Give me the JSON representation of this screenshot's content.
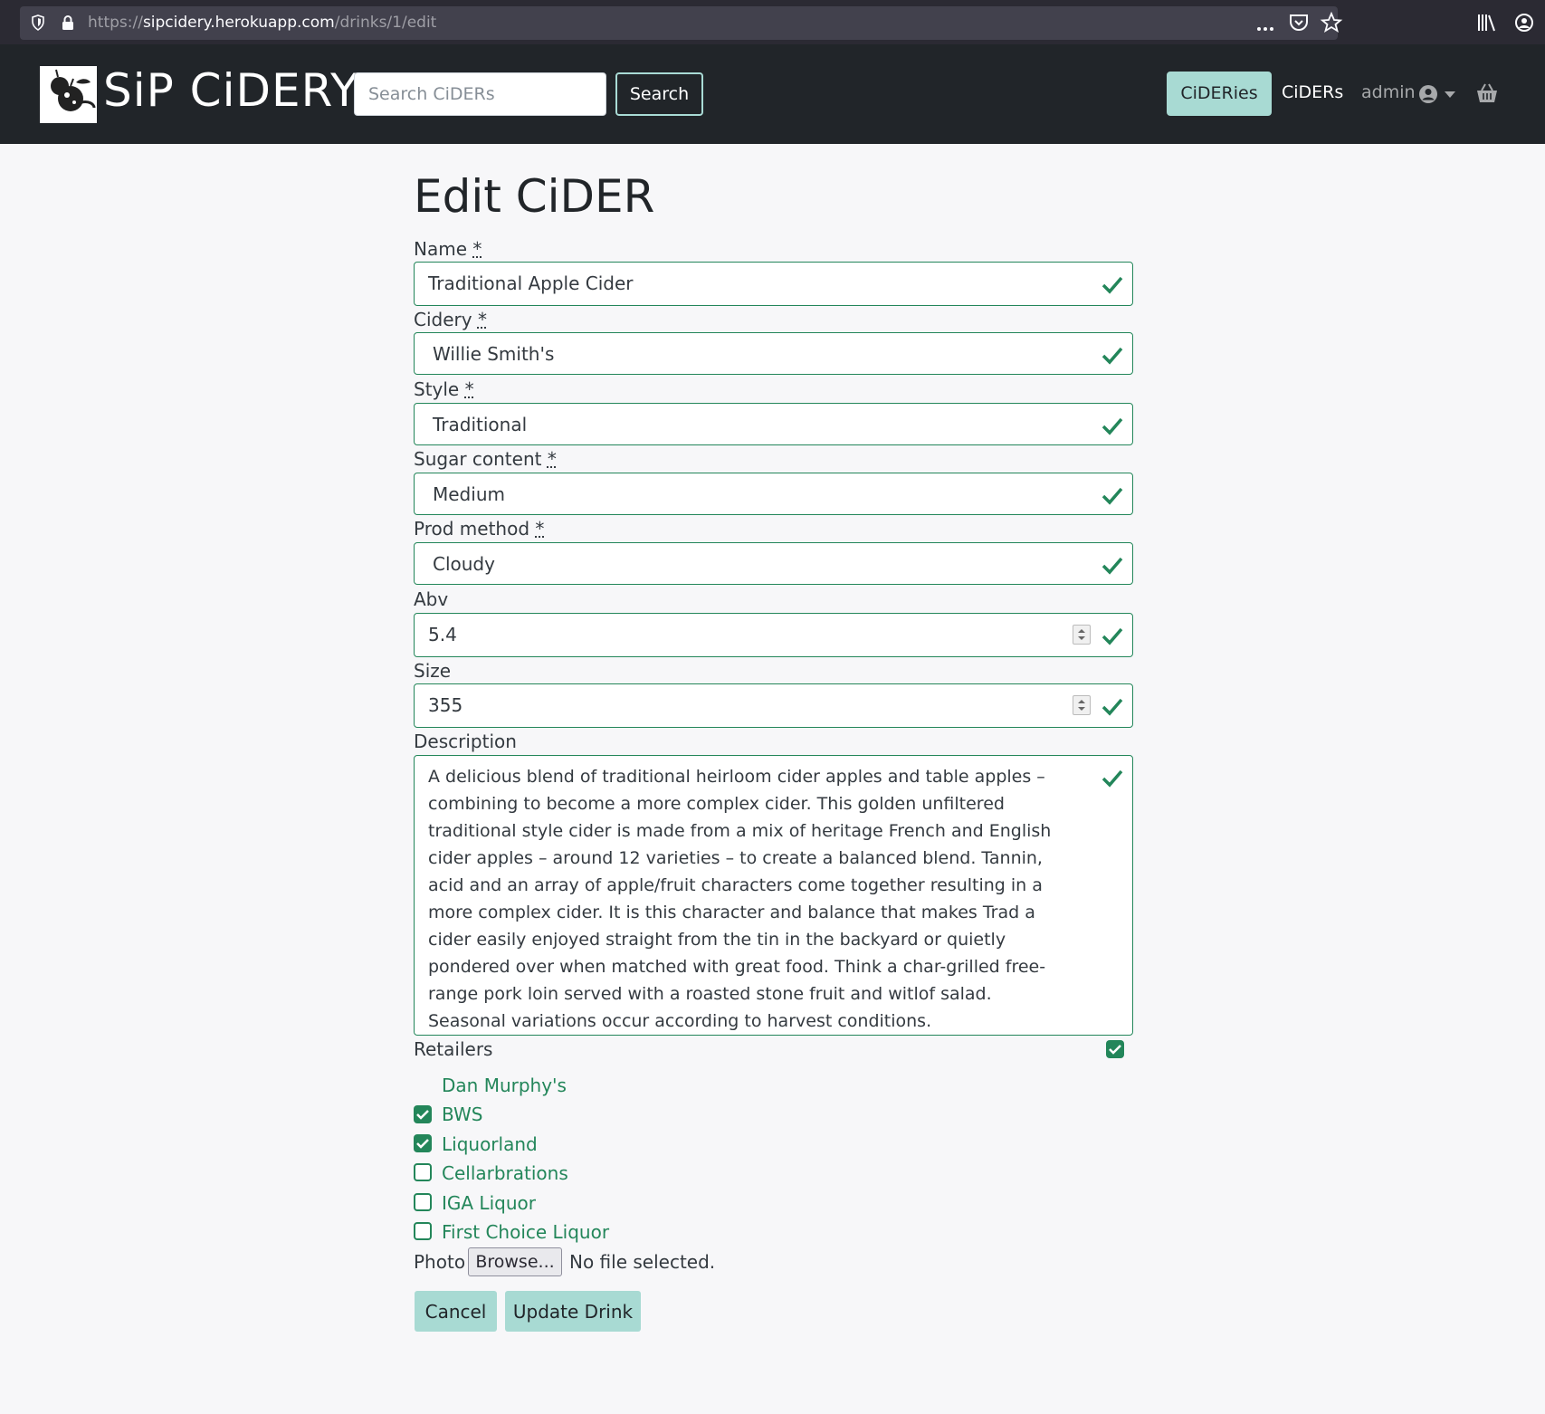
{
  "browser": {
    "url_prefix": "https://",
    "url_host": "sipcidery.herokuapp.com",
    "url_path": "/drinks/1/edit"
  },
  "navbar": {
    "brand": "SiP CiDERY",
    "search_placeholder": "Search CiDERs",
    "search_button": "Search",
    "cideries": "CiDERies",
    "ciders": "CiDERs",
    "user": "admin"
  },
  "form": {
    "title": "Edit CiDER",
    "name_label": "Name",
    "name_value": "Traditional Apple Cider",
    "cidery_label": "Cidery",
    "cidery_value": "Willie Smith's",
    "style_label": "Style",
    "style_value": "Traditional",
    "sugar_label": "Sugar content",
    "sugar_value": "Medium",
    "prod_label": "Prod method",
    "prod_value": "Cloudy",
    "abv_label": "Abv",
    "abv_value": "5.4",
    "size_label": "Size",
    "size_value": "355",
    "description_label": "Description",
    "description_value": "A delicious blend of traditional heirloom cider apples and table apples – combining to become a more complex cider. This golden unfiltered traditional style cider is made from a mix of heritage French and English cider apples – around 12 varieties – to create a balanced blend. Tannin, acid and an array of apple/fruit characters come together resulting in a more complex cider. It is this character and balance that makes Trad a cider easily enjoyed straight from the tin in the backyard or quietly pondered over when matched with great food. Think a char-grilled free-range pork loin served with a roasted stone fruit and witlof salad. Seasonal variations occur according to harvest conditions.",
    "retailers_label": "Retailers",
    "required_mark": "*",
    "retailers": [
      {
        "label": "Dan Murphy's",
        "checked": null
      },
      {
        "label": "BWS",
        "checked": true
      },
      {
        "label": "Liquorland",
        "checked": true
      },
      {
        "label": "Cellarbrations",
        "checked": false
      },
      {
        "label": "IGA Liquor",
        "checked": false
      },
      {
        "label": "First Choice Liquor",
        "checked": false
      }
    ],
    "photo_label": "Photo",
    "browse_button": "Browse...",
    "no_file": "No file selected.",
    "cancel_button": "Cancel",
    "submit_button": "Update Drink"
  },
  "colors": {
    "valid": "#23865a",
    "accent": "#a8dad3",
    "navbar": "#212529"
  }
}
